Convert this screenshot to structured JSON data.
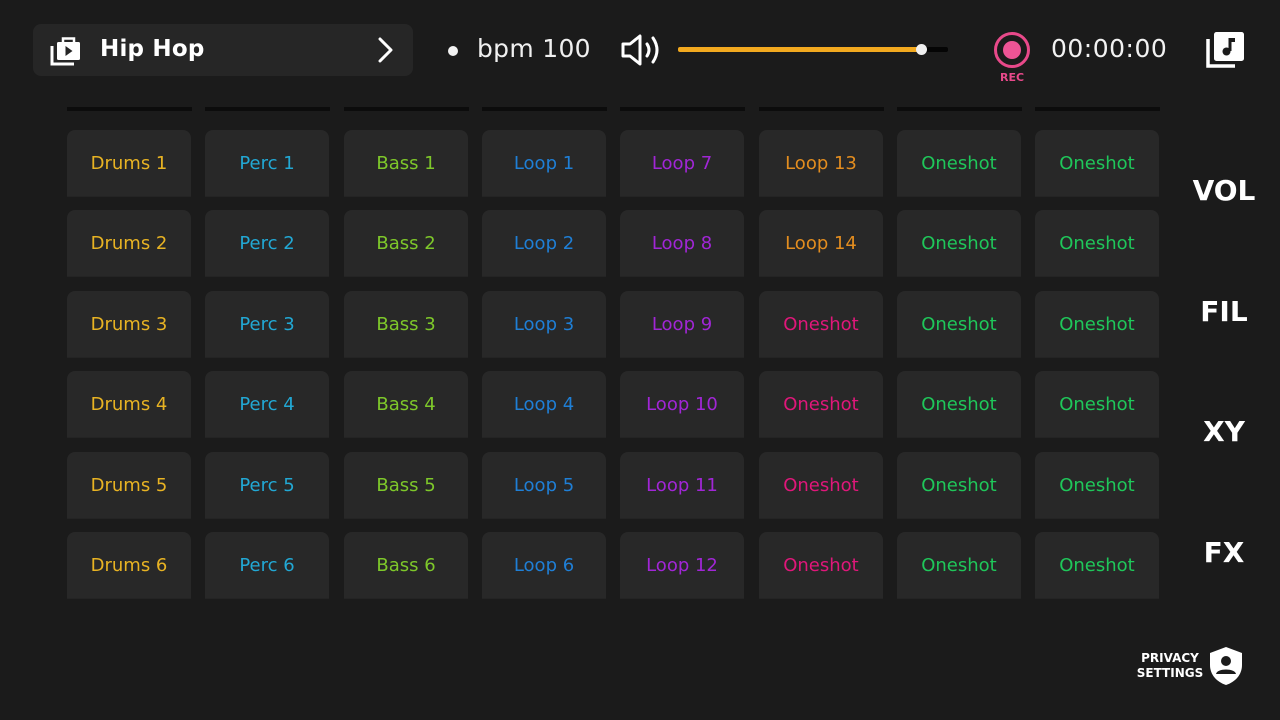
{
  "header": {
    "genre_icon": "music-bag-play-icon",
    "genre_title": "Hip Hop",
    "genre_next_icon": "chevron-right-icon",
    "bpm_label": "bpm 100",
    "volume_icon": "speaker-volume-icon",
    "volume_level_percent": 90,
    "rec_icon": "record-icon",
    "rec_label": "REC",
    "rec_color": "#e8498a",
    "timer": "00:00:00",
    "library_icon": "music-library-icon"
  },
  "colors": {
    "drums": "#e8b323",
    "perc": "#22a8d4",
    "bass": "#7ec82a",
    "loop_blue": "#1f7fd6",
    "loop_purple": "#a126d6",
    "loop_orange": "#e38d1f",
    "oneshot_pink": "#e0177a",
    "oneshot_green": "#1fc75a",
    "slider_fill": "#f2a91f"
  },
  "pads": [
    [
      {
        "label": "Drums 1",
        "color": "#e8b323"
      },
      {
        "label": "Perc 1",
        "color": "#22a8d4"
      },
      {
        "label": "Bass 1",
        "color": "#7ec82a"
      },
      {
        "label": "Loop 1",
        "color": "#1f7fd6"
      },
      {
        "label": "Loop 7",
        "color": "#a126d6"
      },
      {
        "label": "Loop 13",
        "color": "#e38d1f"
      },
      {
        "label": "Oneshot",
        "color": "#1fc75a"
      },
      {
        "label": "Oneshot",
        "color": "#1fc75a"
      }
    ],
    [
      {
        "label": "Drums 2",
        "color": "#e8b323"
      },
      {
        "label": "Perc 2",
        "color": "#22a8d4"
      },
      {
        "label": "Bass 2",
        "color": "#7ec82a"
      },
      {
        "label": "Loop 2",
        "color": "#1f7fd6"
      },
      {
        "label": "Loop 8",
        "color": "#a126d6"
      },
      {
        "label": "Loop 14",
        "color": "#e38d1f"
      },
      {
        "label": "Oneshot",
        "color": "#1fc75a"
      },
      {
        "label": "Oneshot",
        "color": "#1fc75a"
      }
    ],
    [
      {
        "label": "Drums 3",
        "color": "#e8b323"
      },
      {
        "label": "Perc 3",
        "color": "#22a8d4"
      },
      {
        "label": "Bass 3",
        "color": "#7ec82a"
      },
      {
        "label": "Loop 3",
        "color": "#1f7fd6"
      },
      {
        "label": "Loop 9",
        "color": "#a126d6"
      },
      {
        "label": "Oneshot",
        "color": "#e0177a"
      },
      {
        "label": "Oneshot",
        "color": "#1fc75a"
      },
      {
        "label": "Oneshot",
        "color": "#1fc75a"
      }
    ],
    [
      {
        "label": "Drums 4",
        "color": "#e8b323"
      },
      {
        "label": "Perc 4",
        "color": "#22a8d4"
      },
      {
        "label": "Bass 4",
        "color": "#7ec82a"
      },
      {
        "label": "Loop 4",
        "color": "#1f7fd6"
      },
      {
        "label": "Loop 10",
        "color": "#a126d6"
      },
      {
        "label": "Oneshot",
        "color": "#e0177a"
      },
      {
        "label": "Oneshot",
        "color": "#1fc75a"
      },
      {
        "label": "Oneshot",
        "color": "#1fc75a"
      }
    ],
    [
      {
        "label": "Drums 5",
        "color": "#e8b323"
      },
      {
        "label": "Perc 5",
        "color": "#22a8d4"
      },
      {
        "label": "Bass 5",
        "color": "#7ec82a"
      },
      {
        "label": "Loop 5",
        "color": "#1f7fd6"
      },
      {
        "label": "Loop 11",
        "color": "#a126d6"
      },
      {
        "label": "Oneshot",
        "color": "#e0177a"
      },
      {
        "label": "Oneshot",
        "color": "#1fc75a"
      },
      {
        "label": "Oneshot",
        "color": "#1fc75a"
      }
    ],
    [
      {
        "label": "Drums 6",
        "color": "#e8b323"
      },
      {
        "label": "Perc 6",
        "color": "#22a8d4"
      },
      {
        "label": "Bass 6",
        "color": "#7ec82a"
      },
      {
        "label": "Loop 6",
        "color": "#1f7fd6"
      },
      {
        "label": "Loop 12",
        "color": "#a126d6"
      },
      {
        "label": "Oneshot",
        "color": "#e0177a"
      },
      {
        "label": "Oneshot",
        "color": "#1fc75a"
      },
      {
        "label": "Oneshot",
        "color": "#1fc75a"
      }
    ]
  ],
  "side_menu": [
    {
      "label": "VOL"
    },
    {
      "label": "FIL"
    },
    {
      "label": "XY"
    },
    {
      "label": "FX"
    }
  ],
  "privacy": {
    "line1": "PRIVACY",
    "line2": "SETTINGS",
    "icon": "shield-user-icon"
  }
}
